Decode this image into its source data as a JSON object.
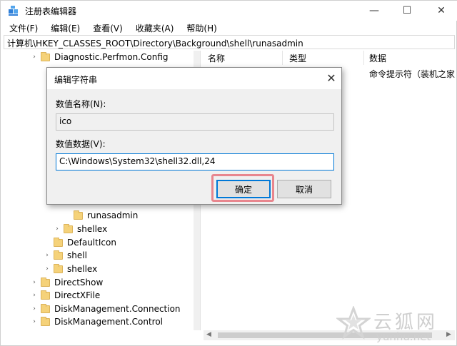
{
  "window": {
    "title": "注册表编辑器",
    "controls": {
      "minimize": "—",
      "maximize": "☐",
      "close": "✕"
    }
  },
  "menu": [
    "文件(F)",
    "编辑(E)",
    "查看(V)",
    "收藏夹(A)",
    "帮助(H)"
  ],
  "address": "计算机\\HKEY_CLASSES_ROOT\\Directory\\Background\\shell\\runasadmin",
  "tree": {
    "items": [
      {
        "label": "Diagnostic.Perfmon.Config",
        "expander": "›"
      },
      {
        "label": "runasadmin",
        "expander": ""
      },
      {
        "label": "shellex",
        "expander": "›"
      },
      {
        "label": "DefaultIcon",
        "expander": ""
      },
      {
        "label": "shell",
        "expander": "›"
      },
      {
        "label": "shellex",
        "expander": "›"
      },
      {
        "label": "DirectShow",
        "expander": "›"
      },
      {
        "label": "DirectXFile",
        "expander": "›"
      },
      {
        "label": "DiskManagement.Connection",
        "expander": "›"
      },
      {
        "label": "DiskManagement.Control",
        "expander": "›"
      }
    ]
  },
  "list": {
    "columns": [
      "名称",
      "类型",
      "数据"
    ],
    "first_row_data": "命令提示符（装机之家）"
  },
  "dialog": {
    "title": "编辑字符串",
    "close": "✕",
    "name_label": "数值名称(N):",
    "name_value": "ico",
    "data_label": "数值数据(V):",
    "data_value": "C:\\Windows\\System32\\shell32.dll,24",
    "ok": "确定",
    "cancel": "取消"
  },
  "watermark": {
    "cn": "云狐网",
    "en": "yunhu.net"
  },
  "colors": {
    "highlight": "#e8868e",
    "focus": "#0078d7",
    "folder": "#f5d27a"
  }
}
